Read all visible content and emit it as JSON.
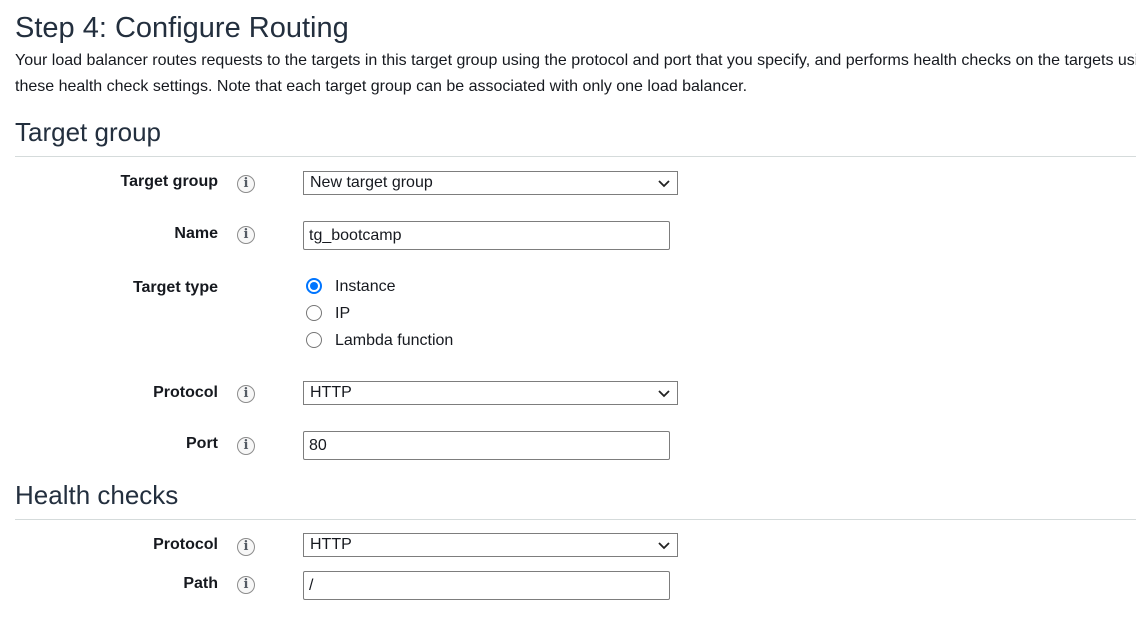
{
  "page": {
    "title": "Step 4: Configure Routing",
    "description": "Your load balancer routes requests to the targets in this target group using the protocol and port that you specify, and performs health checks on the targets using these health check settings. Note that each target group can be associated with only one load balancer."
  },
  "target_group_section": {
    "title": "Target group",
    "target_group": {
      "label": "Target group",
      "value": "New target group"
    },
    "name": {
      "label": "Name",
      "value": "tg_bootcamp"
    },
    "target_type": {
      "label": "Target type",
      "options": [
        "Instance",
        "IP",
        "Lambda function"
      ],
      "selected": "Instance"
    },
    "protocol": {
      "label": "Protocol",
      "value": "HTTP"
    },
    "port": {
      "label": "Port",
      "value": "80"
    }
  },
  "health_checks_section": {
    "title": "Health checks",
    "protocol": {
      "label": "Protocol",
      "value": "HTTP"
    },
    "path": {
      "label": "Path",
      "value": "/"
    }
  },
  "icons": {
    "info": "info-icon",
    "dropdown": "chevron-down-icon"
  },
  "colors": {
    "radio_accent": "#0075ff",
    "heading": "#232f3e",
    "divider": "#d5dbdb"
  }
}
